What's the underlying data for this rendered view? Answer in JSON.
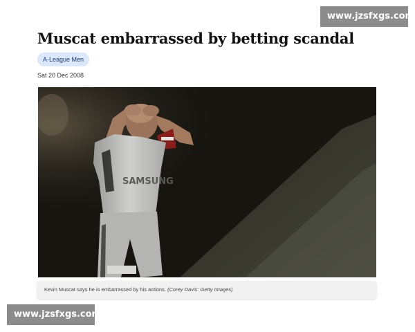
{
  "watermarks": {
    "top": "www.jzsfxgs.com",
    "bottom": "www.jzsfxgs.com"
  },
  "article": {
    "headline": "Muscat embarrassed by betting scandal",
    "tag": "A-League Men",
    "date": "Sat 20 Dec 2008",
    "image": {
      "caption": "Kevin Muscat says he is embarrassed by his actions.",
      "credit": "(Corey Davis: Getty Images)",
      "shirt_text": "SAMSUNG"
    }
  }
}
